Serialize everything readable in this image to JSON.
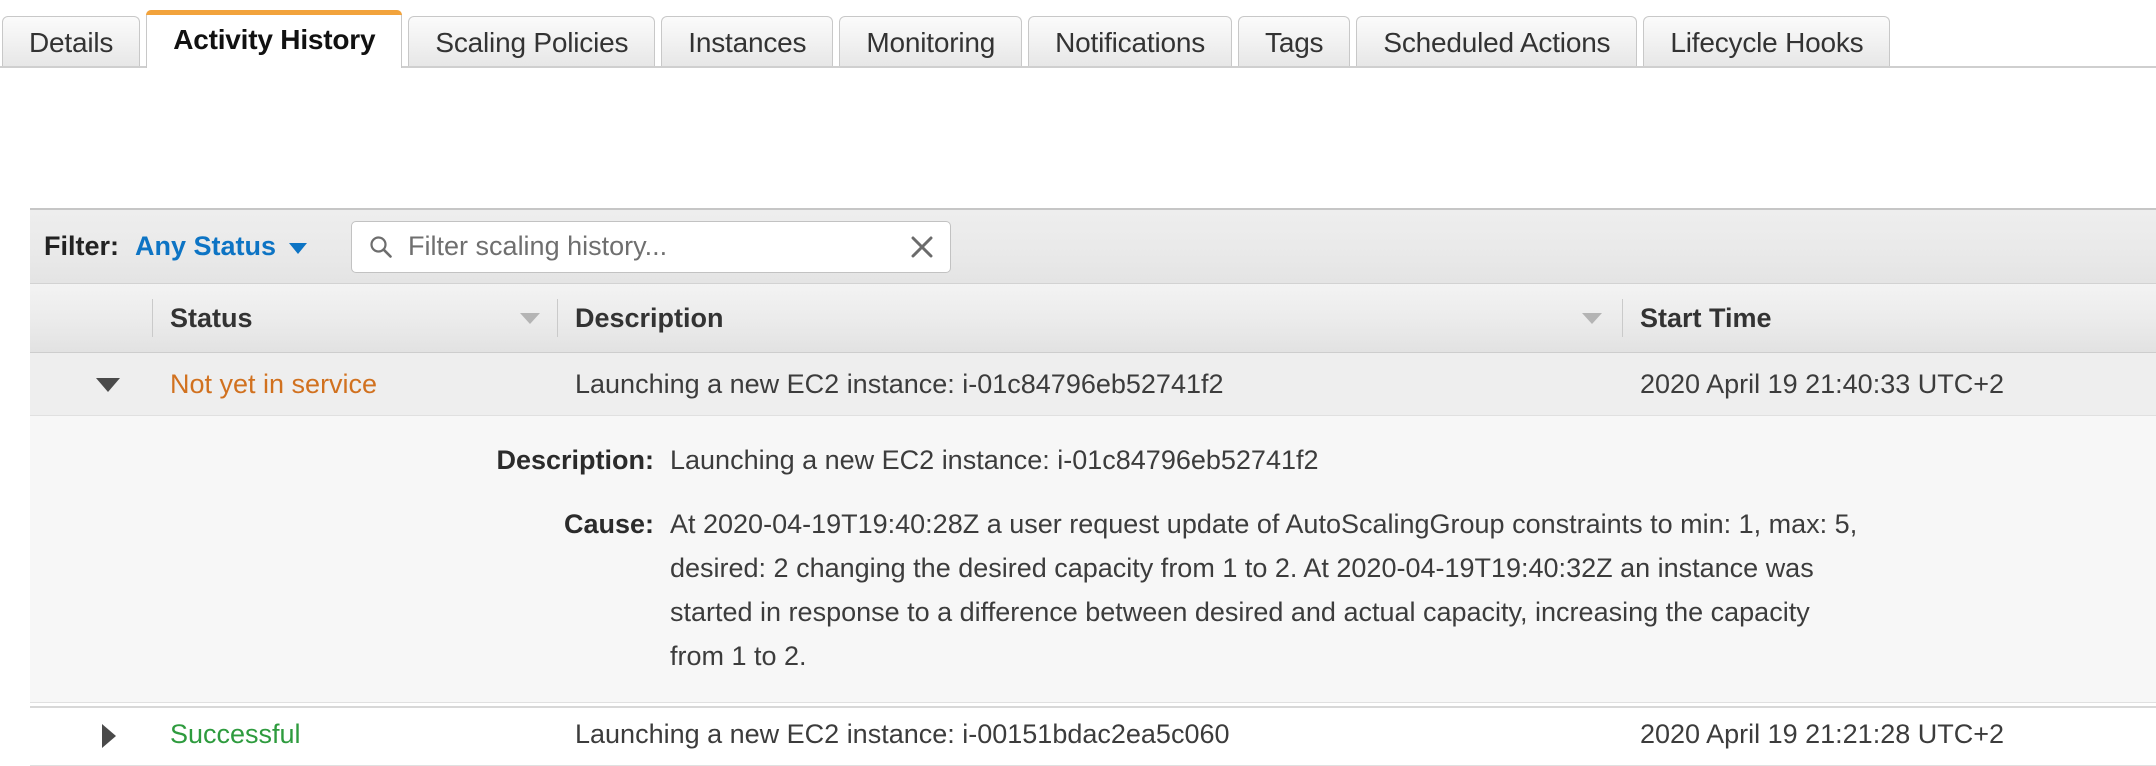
{
  "tabs": [
    {
      "label": "Details",
      "active": false
    },
    {
      "label": "Activity History",
      "active": true
    },
    {
      "label": "Scaling Policies",
      "active": false
    },
    {
      "label": "Instances",
      "active": false
    },
    {
      "label": "Monitoring",
      "active": false
    },
    {
      "label": "Notifications",
      "active": false
    },
    {
      "label": "Tags",
      "active": false
    },
    {
      "label": "Scheduled Actions",
      "active": false
    },
    {
      "label": "Lifecycle Hooks",
      "active": false
    }
  ],
  "filter": {
    "label": "Filter:",
    "status_value": "Any Status",
    "search_placeholder": "Filter scaling history...",
    "search_value": "",
    "clear_icon": "close-icon",
    "search_icon": "search-icon",
    "caret_icon": "chevron-down-icon"
  },
  "table": {
    "columns": [
      {
        "key": "status",
        "label": "Status"
      },
      {
        "key": "description",
        "label": "Description"
      },
      {
        "key": "start_time",
        "label": "Start Time"
      }
    ],
    "rows": [
      {
        "expanded": true,
        "status": "Not yet in service",
        "status_color": "#d1711f",
        "description": "Launching a new EC2 instance: i-01c84796eb52741f2",
        "start_time": "2020 April 19 21:40:33 UTC+2",
        "detail": {
          "description_label": "Description:",
          "description_value": "Launching a new EC2 instance: i-01c84796eb52741f2",
          "cause_label": "Cause:",
          "cause_value": "At 2020-04-19T19:40:28Z a user request update of AutoScalingGroup constraints to min: 1, max: 5, desired: 2 changing the desired capacity from 1 to 2. At 2020-04-19T19:40:32Z an instance was started in response to a difference between desired and actual capacity, increasing the capacity from 1 to 2."
        }
      },
      {
        "expanded": false,
        "status": "Successful",
        "status_color": "#2e9b3e",
        "description": "Launching a new EC2 instance: i-00151bdac2ea5c060",
        "start_time": "2020 April 19 21:21:28 UTC+2",
        "detail": null
      }
    ]
  },
  "colors": {
    "accent_orange": "#f2a33c",
    "link_blue": "#0d74c4",
    "status_warning": "#d1711f",
    "status_success": "#2e9b3e"
  }
}
